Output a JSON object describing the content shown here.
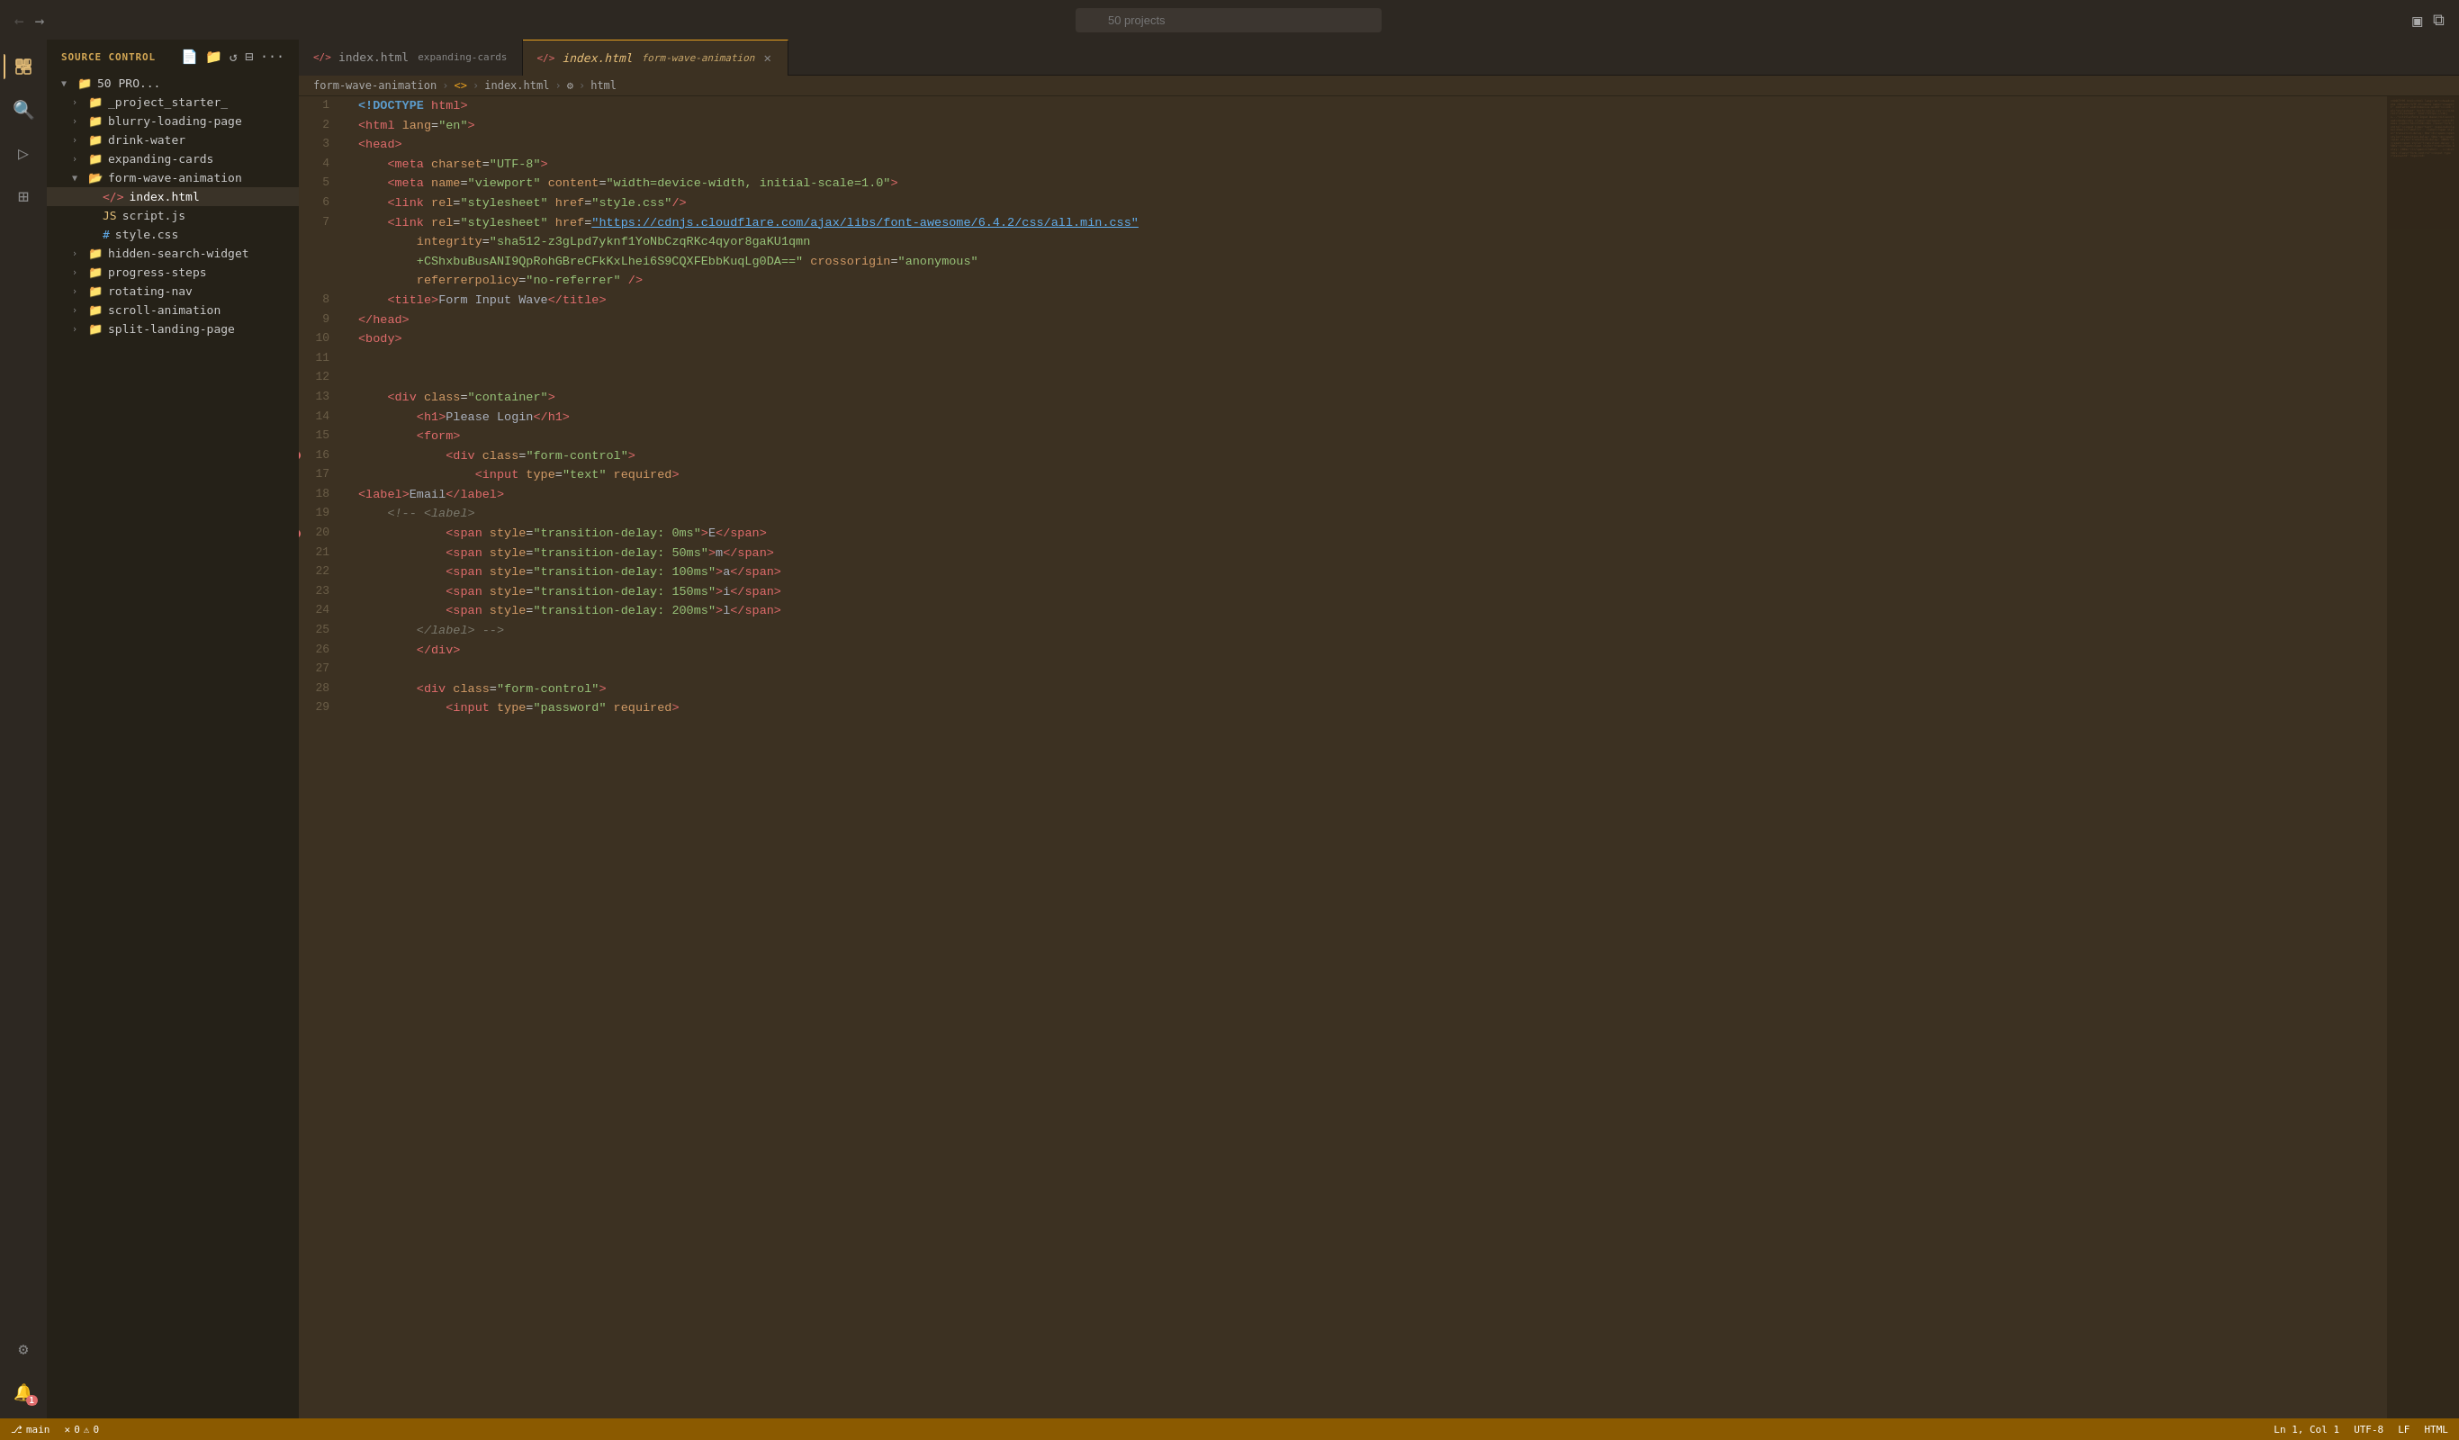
{
  "titlebar": {
    "search_placeholder": "50 projects",
    "nav_back_label": "←",
    "nav_forward_label": "→"
  },
  "tabs": [
    {
      "id": "tab1",
      "icon": "<>",
      "filename": "index.html",
      "project": "expanding-cards",
      "active": false,
      "modified": false
    },
    {
      "id": "tab2",
      "icon": "<>",
      "filename": "index.html",
      "project": "form-wave-animation",
      "active": true,
      "modified": false,
      "closable": true
    }
  ],
  "breadcrumb": {
    "parts": [
      "form-wave-animation",
      "<>",
      "index.html",
      "⚙",
      "html"
    ]
  },
  "sidebar": {
    "title": "SOURCE CONTROL",
    "root_label": "50 PRO...",
    "items": [
      {
        "id": "project_starter",
        "label": "_project_starter_",
        "depth": 1,
        "type": "folder",
        "expanded": false
      },
      {
        "id": "blurry",
        "label": "blurry-loading-page",
        "depth": 1,
        "type": "folder",
        "expanded": false
      },
      {
        "id": "drink",
        "label": "drink-water",
        "depth": 1,
        "type": "folder",
        "expanded": false
      },
      {
        "id": "expanding",
        "label": "expanding-cards",
        "depth": 1,
        "type": "folder",
        "expanded": false
      },
      {
        "id": "formwave",
        "label": "form-wave-animation",
        "depth": 1,
        "type": "folder",
        "expanded": true
      },
      {
        "id": "index_html",
        "label": "index.html",
        "depth": 2,
        "type": "html",
        "active": true
      },
      {
        "id": "script_js",
        "label": "script.js",
        "depth": 2,
        "type": "js"
      },
      {
        "id": "style_css",
        "label": "style.css",
        "depth": 2,
        "type": "css"
      },
      {
        "id": "hidden",
        "label": "hidden-search-widget",
        "depth": 1,
        "type": "folder",
        "expanded": false
      },
      {
        "id": "progress",
        "label": "progress-steps",
        "depth": 1,
        "type": "folder",
        "expanded": false
      },
      {
        "id": "rotating",
        "label": "rotating-nav",
        "depth": 1,
        "type": "folder",
        "expanded": false
      },
      {
        "id": "scroll",
        "label": "scroll-animation",
        "depth": 1,
        "type": "folder",
        "expanded": false
      },
      {
        "id": "split",
        "label": "split-landing-page",
        "depth": 1,
        "type": "folder",
        "expanded": false
      }
    ]
  },
  "code": {
    "lines": [
      {
        "num": 1,
        "html": "<span class='t-doctype'>&lt;!DOCTYPE</span> <span class='t-tag'>html</span><span class='t-bracket'>&gt;</span>"
      },
      {
        "num": 2,
        "html": "<span class='t-bracket'>&lt;</span><span class='t-tag'>html</span> <span class='t-attr'>lang</span>=<span class='t-string'>\"en\"</span><span class='t-bracket'>&gt;</span>"
      },
      {
        "num": 3,
        "html": "<span class='t-bracket'>&lt;</span><span class='t-tag'>head</span><span class='t-bracket'>&gt;</span>"
      },
      {
        "num": 4,
        "html": "    <span class='t-bracket'>&lt;</span><span class='t-tag'>meta</span> <span class='t-attr'>charset</span>=<span class='t-string'>\"UTF-8\"</span><span class='t-bracket'>&gt;</span>",
        "indent": 4
      },
      {
        "num": 5,
        "html": "    <span class='t-bracket'>&lt;</span><span class='t-tag'>meta</span> <span class='t-attr'>name</span>=<span class='t-string'>\"viewport\"</span> <span class='t-attr'>content</span>=<span class='t-string'>\"width=device-width, initial-scale=1.0\"</span><span class='t-bracket'>&gt;</span>",
        "indent": 4
      },
      {
        "num": 6,
        "html": "    <span class='t-bracket'>&lt;</span><span class='t-tag'>link</span> <span class='t-attr'>rel</span>=<span class='t-string'>\"stylesheet\"</span> <span class='t-attr'>href</span>=<span class='t-string'>\"style.css\"</span><span class='t-bracket'>/&gt;</span>",
        "indent": 4
      },
      {
        "num": 7,
        "html": "    <span class='t-bracket'>&lt;</span><span class='t-tag'>link</span> <span class='t-attr'>rel</span>=<span class='t-string'>\"stylesheet\"</span> <span class='t-attr'>href</span>=<span class='t-url'>\"https://cdnjs.cloudflare.com/ajax/libs/font-awesome/6.4.2/css/all.min.css\"</span><br>&nbsp;&nbsp;&nbsp;&nbsp;&nbsp;&nbsp;&nbsp;&nbsp;<span class='t-attr'>integrity</span>=<span class='t-string'>\"sha512-z3gLpd7yknf1YoNbCzqRKc4qyor8gaKU1qmn</span><br>&nbsp;&nbsp;&nbsp;&nbsp;&nbsp;&nbsp;&nbsp;&nbsp;<span class='t-string'>+CShxbuBusANI9QpRohGBreCFkKxLhei6S9CQXFEbbKuqLg0DA==\"</span> <span class='t-attr'>crossorigin</span>=<span class='t-string'>\"anonymous\"</span><br>&nbsp;&nbsp;&nbsp;&nbsp;&nbsp;&nbsp;&nbsp;&nbsp;<span class='t-attr'>referrerpolicy</span>=<span class='t-string'>\"no-referrer\"</span> <span class='t-bracket'>/&gt;</span>"
      },
      {
        "num": 8,
        "html": "    <span class='t-bracket'>&lt;</span><span class='t-tag'>title</span><span class='t-bracket'>&gt;</span><span class='t-text'>Form Input Wave</span><span class='t-bracket'>&lt;/</span><span class='t-tag'>title</span><span class='t-bracket'>&gt;</span>",
        "indent": 4
      },
      {
        "num": 9,
        "html": "<span class='t-bracket'>&lt;/</span><span class='t-tag'>head</span><span class='t-bracket'>&gt;</span>"
      },
      {
        "num": 10,
        "html": "<span class='t-bracket'>&lt;</span><span class='t-tag'>body</span><span class='t-bracket'>&gt;</span>"
      },
      {
        "num": 11,
        "html": ""
      },
      {
        "num": 12,
        "html": ""
      },
      {
        "num": 13,
        "html": "    <span class='t-bracket'>&lt;</span><span class='t-tag'>div</span> <span class='t-attr'>class</span>=<span class='t-string'>\"container\"</span><span class='t-bracket'>&gt;</span>"
      },
      {
        "num": 14,
        "html": "        <span class='t-bracket'>&lt;</span><span class='t-tag'>h1</span><span class='t-bracket'>&gt;</span><span class='t-text'>Please Login</span><span class='t-bracket'>&lt;/</span><span class='t-tag'>h1</span><span class='t-bracket'>&gt;</span>"
      },
      {
        "num": 15,
        "html": "        <span class='t-bracket'>&lt;</span><span class='t-tag'>form</span><span class='t-bracket'>&gt;</span>"
      },
      {
        "num": 16,
        "html": "            <span class='t-bracket'>&lt;</span><span class='t-tag'>div</span> <span class='t-attr'>class</span>=<span class='t-string'>\"form-control\"</span><span class='t-bracket'>&gt;</span>",
        "breakpoint": true
      },
      {
        "num": 17,
        "html": "                <span class='t-bracket'>&lt;</span><span class='t-tag'>input</span> <span class='t-attr'>type</span>=<span class='t-string'>\"text\"</span> <span class='t-attr'>required</span><span class='t-bracket'>&gt;</span>"
      },
      {
        "num": 18,
        "html": "<span class='t-bracket'>&lt;</span><span class='t-tag'>label</span><span class='t-bracket'>&gt;</span><span class='t-text'>Email</span><span class='t-bracket'>&lt;/</span><span class='t-tag'>label</span><span class='t-bracket'>&gt;</span>"
      },
      {
        "num": 19,
        "html": "    <span class='t-comment'>&lt;!-- &lt;label&gt;</span>"
      },
      {
        "num": 20,
        "html": "            <span class='t-bracket'>&lt;</span><span class='t-tag'>span</span> <span class='t-attr'>style</span>=<span class='t-string'>\"transition-delay: 0ms\"</span><span class='t-bracket'>&gt;</span><span class='t-text'>E</span><span class='t-bracket'>&lt;/</span><span class='t-tag'>span</span><span class='t-bracket'>&gt;</span>",
        "breakpoint": true
      },
      {
        "num": 21,
        "html": "            <span class='t-bracket'>&lt;</span><span class='t-tag'>span</span> <span class='t-attr'>style</span>=<span class='t-string'>\"transition-delay: 50ms\"</span><span class='t-bracket'>&gt;</span><span class='t-text'>m</span><span class='t-bracket'>&lt;/</span><span class='t-tag'>span</span><span class='t-bracket'>&gt;</span>"
      },
      {
        "num": 22,
        "html": "            <span class='t-bracket'>&lt;</span><span class='t-tag'>span</span> <span class='t-attr'>style</span>=<span class='t-string'>\"transition-delay: 100ms\"</span><span class='t-bracket'>&gt;</span><span class='t-text'>a</span><span class='t-bracket'>&lt;/</span><span class='t-tag'>span</span><span class='t-bracket'>&gt;</span>"
      },
      {
        "num": 23,
        "html": "            <span class='t-bracket'>&lt;</span><span class='t-tag'>span</span> <span class='t-attr'>style</span>=<span class='t-string'>\"transition-delay: 150ms\"</span><span class='t-bracket'>&gt;</span><span class='t-text'>i</span><span class='t-bracket'>&lt;/</span><span class='t-tag'>span</span><span class='t-bracket'>&gt;</span>"
      },
      {
        "num": 24,
        "html": "            <span class='t-bracket'>&lt;</span><span class='t-tag'>span</span> <span class='t-attr'>style</span>=<span class='t-string'>\"transition-delay: 200ms\"</span><span class='t-bracket'>&gt;</span><span class='t-text'>l</span><span class='t-bracket'>&lt;/</span><span class='t-tag'>span</span><span class='t-bracket'>&gt;</span>"
      },
      {
        "num": 25,
        "html": "        <span class='t-comment'>&lt;/label&gt; --&gt;</span>"
      },
      {
        "num": 26,
        "html": "        <span class='t-bracket'>&lt;/</span><span class='t-tag'>div</span><span class='t-bracket'>&gt;</span>"
      },
      {
        "num": 27,
        "html": ""
      },
      {
        "num": 28,
        "html": "        <span class='t-bracket'>&lt;</span><span class='t-tag'>div</span> <span class='t-attr'>class</span>=<span class='t-string'>\"form-control\"</span><span class='t-bracket'>&gt;</span>"
      },
      {
        "num": 29,
        "html": "            <span class='t-bracket'>&lt;</span><span class='t-tag'>input</span> <span class='t-attr'>type</span>=<span class='t-string'>\"password\"</span> <span class='t-attr'>required</span><span class='t-bracket'>&gt;</span>"
      }
    ]
  },
  "status": {
    "branch": "main",
    "errors": "0",
    "warnings": "0",
    "encoding": "UTF-8",
    "line_ending": "LF",
    "language": "HTML",
    "line_col": "Ln 1, Col 1"
  }
}
